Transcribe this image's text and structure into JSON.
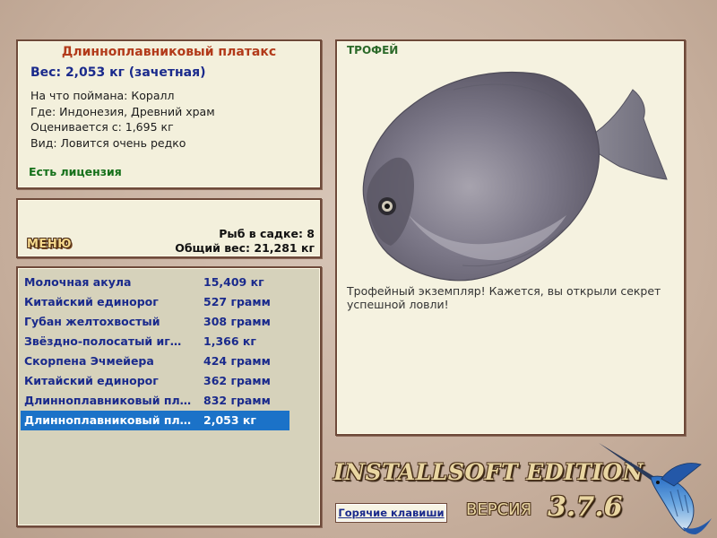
{
  "fish_info": {
    "name": "Длинноплавниковый платакс",
    "weight": "Вес: 2,053 кг (зачетная)",
    "bait": "На что поймана: Коралл",
    "location": "Где: Индонезия, Древний храм",
    "valued_from": "Оценивается с: 1,695 кг",
    "rarity": "Вид: Ловится очень редко",
    "license": "Есть лицензия"
  },
  "menu": {
    "label": "МЕНЮ",
    "fish_in_net": "Рыб в садке: 8",
    "total_weight": "Общий вес: 21,281 кг"
  },
  "catch_list": [
    {
      "name": "Молочная акула",
      "weight": "15,409 кг",
      "selected": false
    },
    {
      "name": "Китайский единорог",
      "weight": "527 грамм",
      "selected": false
    },
    {
      "name": "Губан желтохвостый",
      "weight": "308 грамм",
      "selected": false
    },
    {
      "name": "Звёздно-полосатый иг…",
      "weight": "1,366 кг",
      "selected": false
    },
    {
      "name": "Скорпена Эчмейера",
      "weight": "424 грамм",
      "selected": false
    },
    {
      "name": "Китайский единорог",
      "weight": "362 грамм",
      "selected": false
    },
    {
      "name": "Длинноплавниковый пл…",
      "weight": "832 грамм",
      "selected": false
    },
    {
      "name": "Длинноплавниковый пл…",
      "weight": "2,053 кг",
      "selected": true
    }
  ],
  "trophy": {
    "badge": "ТРОФЕЙ",
    "image_icon": "batfish-image",
    "message": "Трофейный экземпляр! Кажется, вы открыли секрет успешной ловли!"
  },
  "branding": {
    "edition": "INSTALLSOFT EDITION",
    "version_label": "ВЕРСИЯ",
    "version_number": "3.7.6",
    "logo_icon": "marlin-icon"
  },
  "hotkeys_label": "Горячие клавиши",
  "colors": {
    "accent_title": "#b23a1a",
    "accent_blue": "#1a2a8c",
    "license_green": "#15701a",
    "selection": "#1b72c8"
  }
}
